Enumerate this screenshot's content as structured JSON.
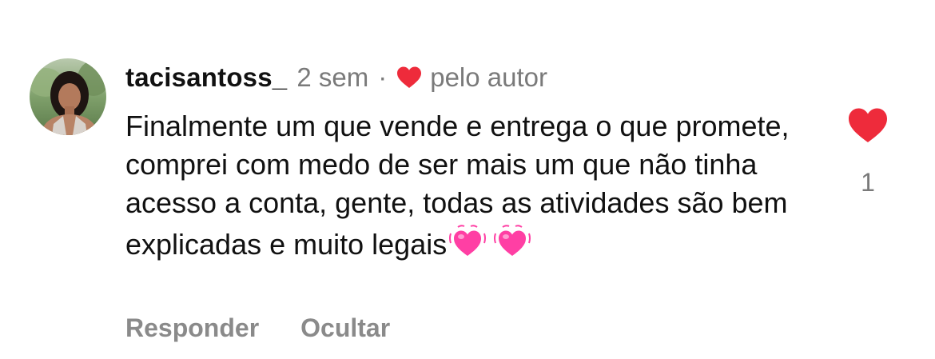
{
  "comment": {
    "username": "tacisantoss_",
    "time": "2 sem",
    "separator": "·",
    "liked_by_author_label": "pelo autor",
    "text": "Finalmente um que vende e entrega o que promete, comprei com medo de ser mais um que não tinha acesso a conta, gente, todas as atividades são bem explicadas e muito legais",
    "emojis": [
      "💓",
      "💓"
    ],
    "actions": {
      "reply": "Responder",
      "hide": "Ocultar"
    },
    "like_count": "1",
    "liked": true,
    "icons": {
      "author_heart": "heart-icon",
      "like_heart": "heart-filled-icon"
    },
    "colors": {
      "heart": "#ee2b3b",
      "secondary_text": "#7a7a7a",
      "emoji": "#ff3fa4"
    }
  }
}
